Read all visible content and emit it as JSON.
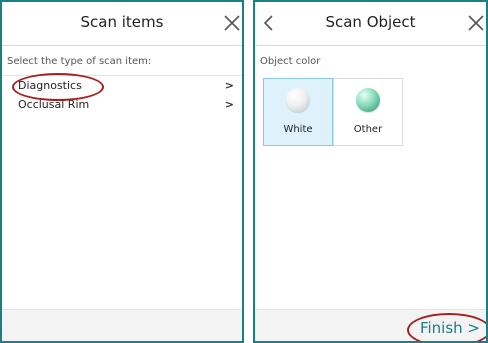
{
  "left_panel": {
    "title": "Scan items",
    "section_label": "Select the type of scan item:",
    "items": [
      {
        "label": "Diagnostics",
        "chevron": ">"
      },
      {
        "label": "Occlusal Rim",
        "chevron": ">"
      }
    ]
  },
  "right_panel": {
    "title": "Scan Object",
    "section_label": "Object color",
    "colors": [
      {
        "label": "White",
        "selected": true
      },
      {
        "label": "Other",
        "selected": false
      }
    ],
    "finish_label": "Finish",
    "finish_chevron": ">"
  },
  "colors": {
    "accent": "#1a7f86",
    "highlight_ellipse": "#a32020",
    "selected_tile": "#dff2fb"
  },
  "icons": [
    "close-icon",
    "back-icon",
    "chevron-right-icon"
  ]
}
